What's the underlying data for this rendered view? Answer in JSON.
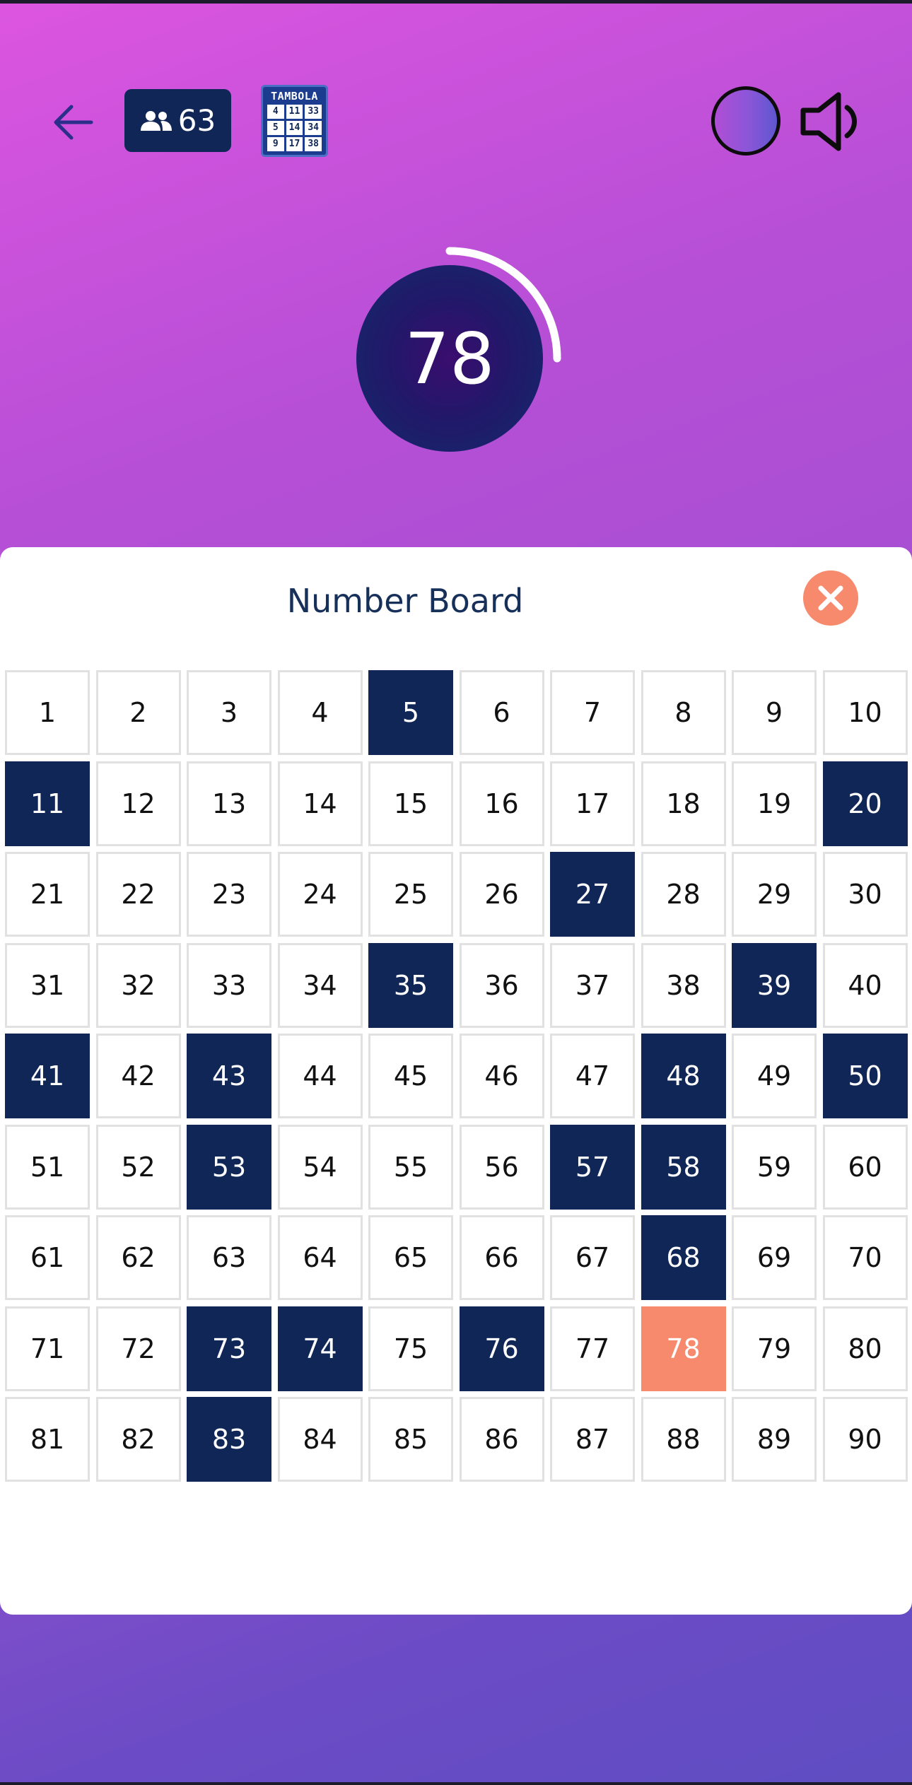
{
  "header": {
    "players_count": "63",
    "logo": {
      "title": "TAMBOLA",
      "numbers": [
        "4",
        "11",
        "33",
        "5",
        "14",
        "34",
        "9",
        "17",
        "38"
      ]
    }
  },
  "current_call": {
    "number": "78",
    "timer_progress": 0.25
  },
  "board": {
    "title": "Number Board",
    "numbers": [
      1,
      2,
      3,
      4,
      5,
      6,
      7,
      8,
      9,
      10,
      11,
      12,
      13,
      14,
      15,
      16,
      17,
      18,
      19,
      20,
      21,
      22,
      23,
      24,
      25,
      26,
      27,
      28,
      29,
      30,
      31,
      32,
      33,
      34,
      35,
      36,
      37,
      38,
      39,
      40,
      41,
      42,
      43,
      44,
      45,
      46,
      47,
      48,
      49,
      50,
      51,
      52,
      53,
      54,
      55,
      56,
      57,
      58,
      59,
      60,
      61,
      62,
      63,
      64,
      65,
      66,
      67,
      68,
      69,
      70,
      71,
      72,
      73,
      74,
      75,
      76,
      77,
      78,
      79,
      80,
      81,
      82,
      83,
      84,
      85,
      86,
      87,
      88,
      89,
      90
    ],
    "called_numbers": [
      5,
      11,
      20,
      27,
      35,
      39,
      41,
      43,
      48,
      50,
      53,
      57,
      58,
      68,
      73,
      74,
      76,
      83
    ],
    "current_number": 78
  },
  "colors": {
    "called": "#0f2657",
    "current": "#f7896c",
    "accent": "#f7896c"
  },
  "icons": {
    "back": "arrow-left-icon",
    "players": "people-icon",
    "theme": "theme-toggle-icon",
    "sound": "speaker-icon",
    "close": "close-icon"
  }
}
